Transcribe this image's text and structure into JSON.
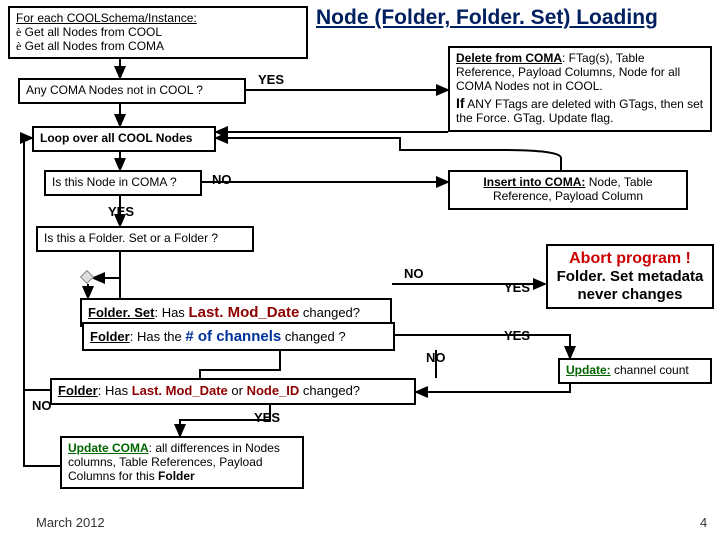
{
  "title": "Node (Folder, Folder. Set)  Loading",
  "boxes": {
    "start_l1": "For each COOLSchema/Instance:",
    "start_l2a": "è",
    "start_l2b": " Get all Nodes from COOL",
    "start_l3a": "è",
    "start_l3b": " Get all Nodes from COMA",
    "anycoma": "Any COMA Nodes not in COOL ?",
    "loop": "Loop over all COOL Nodes",
    "isnode": "Is this Node in COMA ?",
    "isfs": "Is this a Folder. Set or a Folder ?",
    "fsset_a": "Folder. Set",
    "fsset_b": ": Has ",
    "fsset_c": "Last. Mod_Date",
    "fsset_d": " changed?",
    "fch_a": "Folder",
    "fch_b": ": Has the ",
    "fch_c": "# of channels",
    "fch_d": " changed ?",
    "flm_a": "Folder",
    "flm_b": ": Has ",
    "flm_c": "Last. Mod_Date",
    "flm_d": " or ",
    "flm_e": "Node_ID",
    "flm_f": " changed?",
    "upd_a": "Update COMA",
    "upd_b": ": all differences in Nodes columns, Table References, Payload Columns for this ",
    "upd_c": "Folder",
    "del_a": "Delete from COMA",
    "del_b": ": FTag(s), Table Reference, Payload Columns, Node for all COMA Nodes not in COOL.",
    "del_c": "If",
    "del_d": " ANY FTags are deleted with GTags, then set the Force. GTag. Update flag.",
    "ins_a": "Insert into COMA:",
    "ins_b": " Node, Table Reference, Payload Column",
    "abort_a": "Abort program !",
    "abort_b": "Folder. Set metadata",
    "abort_c": "never changes",
    "updch_a": "Update:",
    "updch_b": " channel count"
  },
  "labels": {
    "yes1": "YES",
    "no1": "NO",
    "yes2": "YES",
    "no2": "NO",
    "yes3": "YES",
    "yes4": "YES",
    "no3": "NO",
    "no4": "NO",
    "yes5": "YES"
  },
  "footer_date": "March  2012",
  "footer_page": "4"
}
